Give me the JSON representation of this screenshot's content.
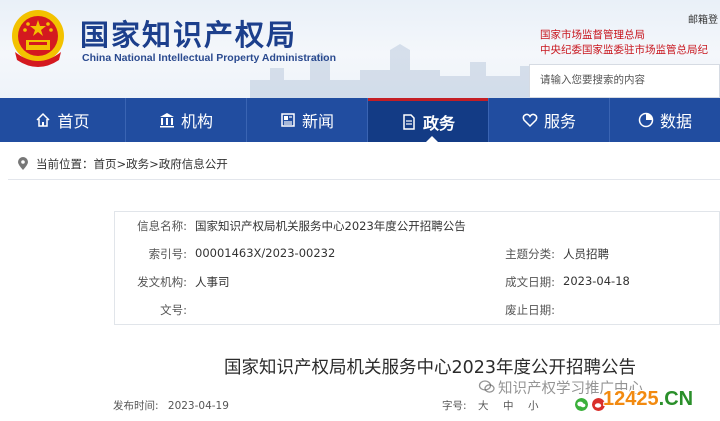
{
  "header": {
    "logo_cn": "国家知识产权局",
    "logo_en": "China National Intellectual Property Administration",
    "mail_label": "邮箱登",
    "links": [
      "国家市场监督管理总局",
      "中央纪委国家监委驻市场监管总局纪"
    ],
    "search_placeholder": "请输入您要搜索的内容"
  },
  "nav": {
    "items": [
      {
        "label": "首页",
        "icon": "home-icon"
      },
      {
        "label": "机构",
        "icon": "building-icon"
      },
      {
        "label": "新闻",
        "icon": "newspaper-icon"
      },
      {
        "label": "政务",
        "icon": "document-icon",
        "active": true
      },
      {
        "label": "服务",
        "icon": "heart-hand-icon"
      },
      {
        "label": "数据",
        "icon": "pie-chart-icon"
      }
    ],
    "active_color": "#133b85",
    "bar_color": "#214da0"
  },
  "breadcrumb": {
    "prefix": "当前位置：",
    "items": [
      "首页",
      "政务",
      "政府信息公开"
    ],
    "separator": ">"
  },
  "info": {
    "name_label": "信息名称:",
    "name_value": "国家知识产权局机关服务中心2023年度公开招聘公告",
    "index_label": "索引号:",
    "index_value": "00001463X/2023-00232",
    "topic_label": "主题分类:",
    "topic_value": "人员招聘",
    "org_label": "发文机构:",
    "org_value": "人事司",
    "date_label": "成文日期:",
    "date_value": "2023-04-18",
    "doc_label": "文号:",
    "doc_value": "",
    "expire_label": "废止日期:",
    "expire_value": ""
  },
  "article": {
    "title": "国家知识产权局机关服务中心2023年度公开招聘公告",
    "publish_label": "发布时间:",
    "publish_date": "2023-04-19",
    "font_size_label": "字号:",
    "font_sizes": [
      "大",
      "中",
      "小"
    ]
  },
  "watermark": {
    "account_text": "知识产权学习推广中心",
    "brand_num": "12425",
    "brand_dot": ".",
    "brand_tld": "CN"
  }
}
